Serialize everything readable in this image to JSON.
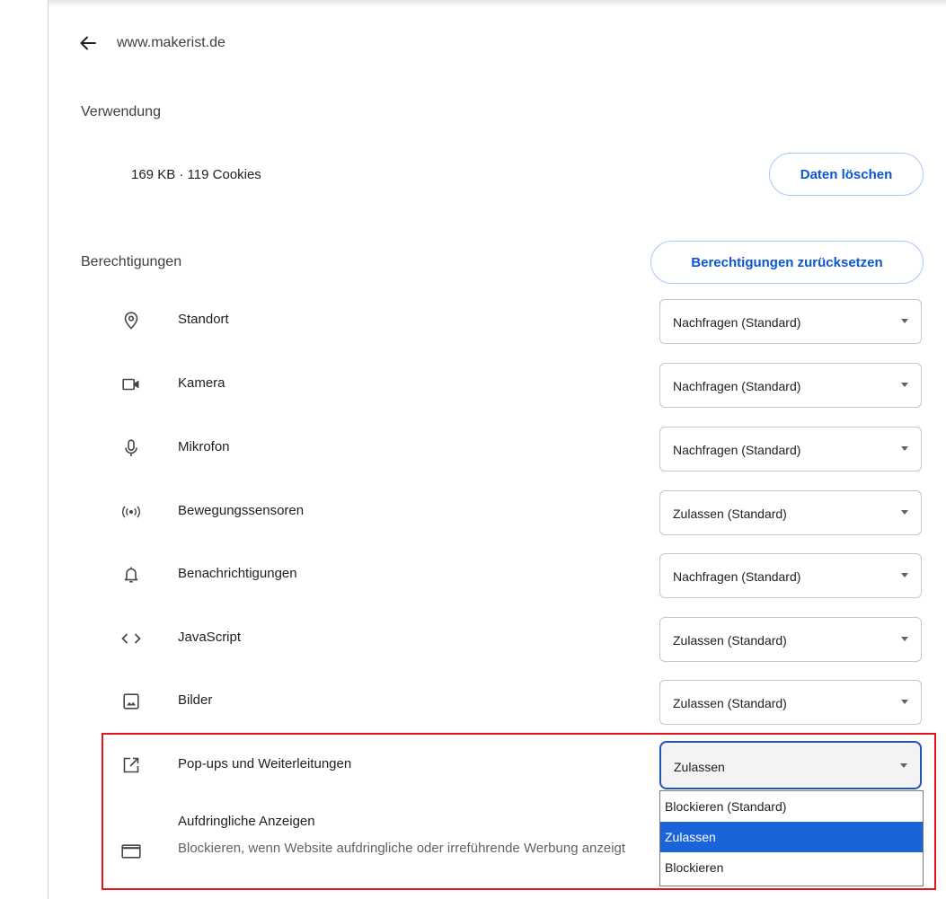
{
  "header": {
    "site": "www.makerist.de",
    "back_icon": "arrow-left-icon"
  },
  "usage": {
    "label": "Verwendung",
    "summary": "169 KB · 119 Cookies",
    "clear_button": "Daten löschen"
  },
  "permissions": {
    "label": "Berechtigungen",
    "reset_button": "Berechtigungen zurücksetzen",
    "items": [
      {
        "icon": "location-pin-icon",
        "label": "Standort",
        "value": "Nachfragen (Standard)"
      },
      {
        "icon": "camera-icon",
        "label": "Kamera",
        "value": "Nachfragen (Standard)"
      },
      {
        "icon": "microphone-icon",
        "label": "Mikrofon",
        "value": "Nachfragen (Standard)"
      },
      {
        "icon": "motion-sensors-icon",
        "label": "Bewegungssensoren",
        "value": "Zulassen (Standard)"
      },
      {
        "icon": "bell-icon",
        "label": "Benachrichtigungen",
        "value": "Nachfragen (Standard)"
      },
      {
        "icon": "code-icon",
        "label": "JavaScript",
        "value": "Zulassen (Standard)"
      },
      {
        "icon": "image-icon",
        "label": "Bilder",
        "value": "Zulassen (Standard)"
      },
      {
        "icon": "open-in-new-icon",
        "label": "Pop-ups und Weiterleitungen",
        "value": "Zulassen"
      }
    ],
    "intrusive_ads": {
      "icon": "ad-window-icon",
      "label": "Aufdringliche Anzeigen",
      "description": "Blockieren, wenn Website aufdringliche oder irreführende Werbung anzeigt"
    }
  },
  "popup_dropdown": {
    "options": [
      "Blockieren (Standard)",
      "Zulassen",
      "Blockieren"
    ],
    "selected": "Zulassen"
  },
  "colors": {
    "accent": "#0b57d0",
    "highlight_border": "#e3151a",
    "dropdown_selected": "#1a63d8"
  }
}
